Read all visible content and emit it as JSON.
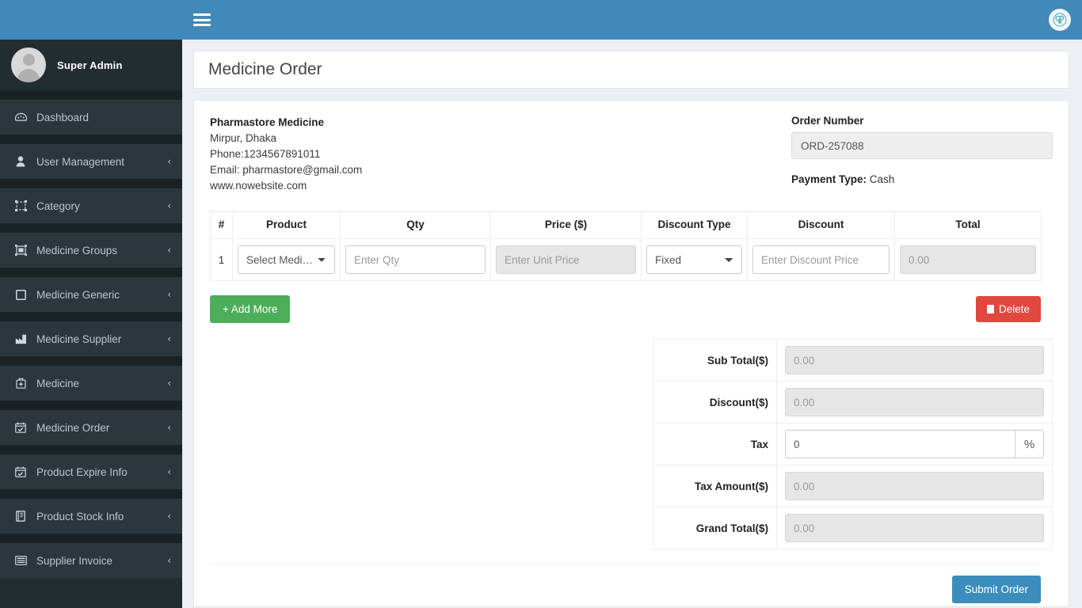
{
  "header": {
    "menu_toggle_label": "Toggle navigation",
    "brand_color": "#4189b8",
    "user_avatar_label": "User"
  },
  "sidebar": {
    "user": {
      "name": "Super Admin",
      "avatar_label": "Super Admin avatar"
    },
    "items": [
      {
        "label": "Dashboard",
        "icon": "dashboard-icon",
        "has_arrow": false
      },
      {
        "label": "User Management",
        "icon": "user-icon",
        "has_arrow": true
      },
      {
        "label": "Category",
        "icon": "category-icon",
        "has_arrow": true
      },
      {
        "label": "Medicine Groups",
        "icon": "groups-icon",
        "has_arrow": true
      },
      {
        "label": "Medicine Generic",
        "icon": "square-icon",
        "has_arrow": true
      },
      {
        "label": "Medicine Supplier",
        "icon": "factory-icon",
        "has_arrow": true
      },
      {
        "label": "Medicine",
        "icon": "medicine-icon",
        "has_arrow": true
      },
      {
        "label": "Medicine Order",
        "icon": "calendar-check-icon",
        "has_arrow": true
      },
      {
        "label": "Product Expire Info",
        "icon": "calendar-expire-icon",
        "has_arrow": true
      },
      {
        "label": "Product Stock Info",
        "icon": "book-icon",
        "has_arrow": true
      },
      {
        "label": "Supplier Invoice",
        "icon": "invoice-icon",
        "has_arrow": true
      }
    ]
  },
  "page": {
    "title": "Medicine Order"
  },
  "store": {
    "name": "Pharmastore Medicine",
    "address": "Mirpur, Dhaka",
    "phone": "Phone:1234567891011",
    "email": "Email: pharmastore@gmail.com",
    "website": "www.nowebsite.com"
  },
  "order": {
    "number_label": "Order Number",
    "number_value": "ORD-257088",
    "payment_type_label": "Payment Type:",
    "payment_type_value": "Cash"
  },
  "table": {
    "columns": [
      "#",
      "Product",
      "Qty",
      "Price ($)",
      "Discount Type",
      "Discount",
      "Total"
    ],
    "rows": [
      {
        "index": "1",
        "product_selected": "Select Medicine",
        "qty_placeholder": "Enter Qty",
        "qty_value": "",
        "price_placeholder": "Enter Unit Price",
        "price_value": "",
        "discount_type_selected": "Fixed",
        "discount_placeholder": "Enter Discount Price",
        "discount_value": "",
        "total_placeholder": "0.00",
        "total_value": ""
      }
    ]
  },
  "actions": {
    "add_more_label": "+ Add More",
    "delete_label": "Delete",
    "submit_label": "Submit Order"
  },
  "totals": [
    {
      "label": "Sub Total($)",
      "placeholder": "0.00",
      "value": "",
      "readonly": true,
      "addon": ""
    },
    {
      "label": "Discount($)",
      "placeholder": "0.00",
      "value": "",
      "readonly": true,
      "addon": ""
    },
    {
      "label": "Tax",
      "placeholder": "",
      "value": "0",
      "readonly": false,
      "addon": "%"
    },
    {
      "label": "Tax Amount($)",
      "placeholder": "0.00",
      "value": "",
      "readonly": true,
      "addon": ""
    },
    {
      "label": "Grand Total($)",
      "placeholder": "0.00",
      "value": "",
      "readonly": true,
      "addon": ""
    }
  ],
  "colors": {
    "sidebar_bg": "#222d32",
    "sidebar_item_bg": "#2b373c",
    "header_blue": "#4189b8",
    "add_green": "#4cae5a",
    "delete_red": "#e0473e",
    "submit_blue": "#3c8dbc",
    "content_bg": "#ecf0f5"
  }
}
